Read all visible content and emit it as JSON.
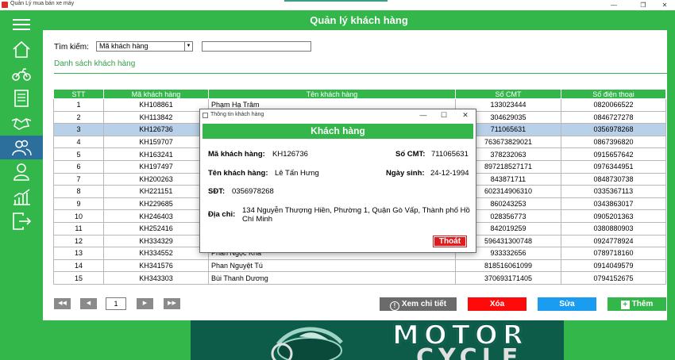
{
  "window": {
    "title": "Quản Lý mua bán xe máy",
    "minimize": "—",
    "maximize": "❐",
    "close": "✕"
  },
  "header": {
    "title": "Quản lý khách hàng"
  },
  "sidebar": {
    "items": [
      {
        "icon": "menu-icon"
      },
      {
        "icon": "home-icon"
      },
      {
        "icon": "motorcycle-icon"
      },
      {
        "icon": "invoice-icon"
      },
      {
        "icon": "handshake-icon"
      },
      {
        "icon": "customers-icon",
        "active": true
      },
      {
        "icon": "employee-icon"
      },
      {
        "icon": "statistics-icon"
      },
      {
        "icon": "logout-icon"
      }
    ]
  },
  "search": {
    "label": "Tìm kiếm:",
    "field_selected": "Mã khách hàng",
    "value": ""
  },
  "list": {
    "title": "Danh sách khách hàng"
  },
  "table": {
    "columns": [
      "STT",
      "Mã khách hàng",
      "Tên khách hàng",
      "Số CMT",
      "Số điện thoại"
    ],
    "rows": [
      [
        "1",
        "KH108861",
        "Phạm Hạ Trâm",
        "133023444",
        "0820066522"
      ],
      [
        "2",
        "KH113842",
        "",
        "304629035",
        "0846727278"
      ],
      [
        "3",
        "KH126736",
        "",
        "711065631",
        "0356978268"
      ],
      [
        "4",
        "KH159707",
        "",
        "763673829021",
        "0867396820"
      ],
      [
        "5",
        "KH163241",
        "",
        "378232063",
        "0915657642"
      ],
      [
        "6",
        "KH197497",
        "",
        "897218527171",
        "0976344951"
      ],
      [
        "7",
        "KH200263",
        "",
        "843871711",
        "0848730738"
      ],
      [
        "8",
        "KH221151",
        "",
        "602314906310",
        "0335367113"
      ],
      [
        "9",
        "KH229685",
        "",
        "860243253",
        "0343863017"
      ],
      [
        "10",
        "KH246403",
        "",
        "028356773",
        "0905201363"
      ],
      [
        "11",
        "KH252416",
        "",
        "842019259",
        "0380880903"
      ],
      [
        "12",
        "KH334329",
        "",
        "596431300748",
        "0924778924"
      ],
      [
        "13",
        "KH334552",
        "Phan Ngọc Khả",
        "933332656",
        "0789718160"
      ],
      [
        "14",
        "KH341576",
        "Phan Nguyệt Tú",
        "818516061099",
        "0914049579"
      ],
      [
        "15",
        "KH343303",
        "Bùi Thanh Dương",
        "370693171405",
        "0794152675"
      ]
    ],
    "selected_row": 3
  },
  "pager": {
    "first": "◀◀",
    "prev": "◀",
    "page": "1",
    "next": "▶",
    "last": "▶▶"
  },
  "actions": {
    "detail": "Xem chi tiết",
    "delete": "Xóa",
    "edit": "Sửa",
    "add": "Thêm"
  },
  "colors": {
    "green": "#33b64a",
    "active_nav": "#2d6f9c",
    "delete": "#ff0a0a",
    "edit": "#1a9df0",
    "detail": "#6b6b6b",
    "selected_row": "#b8d0e8"
  },
  "logo": {
    "line1": "MOTOR",
    "line2": "CYCLE"
  },
  "dialog": {
    "window_title": "Thông tin khách hàng",
    "minimize": "—",
    "maximize": "☐",
    "close": "✕",
    "header": "Khách hàng",
    "code_label": "Mã khách hàng:",
    "code_value": "KH126736",
    "id_label": "Số CMT:",
    "id_value": "711065631",
    "name_label": "Tên khách hàng:",
    "name_value": "Lê Tấn Hưng",
    "dob_label": "Ngày sinh:",
    "dob_value": "24-12-1994",
    "phone_label": "SĐT:",
    "phone_value": "0356978268",
    "address_label": "Địa chỉ:",
    "address_value": "134 Nguyễn Thượng Hiền, Phường 1, Quận Gò Vấp, Thành phố Hồ Chí Minh",
    "exit": "Thoát"
  }
}
